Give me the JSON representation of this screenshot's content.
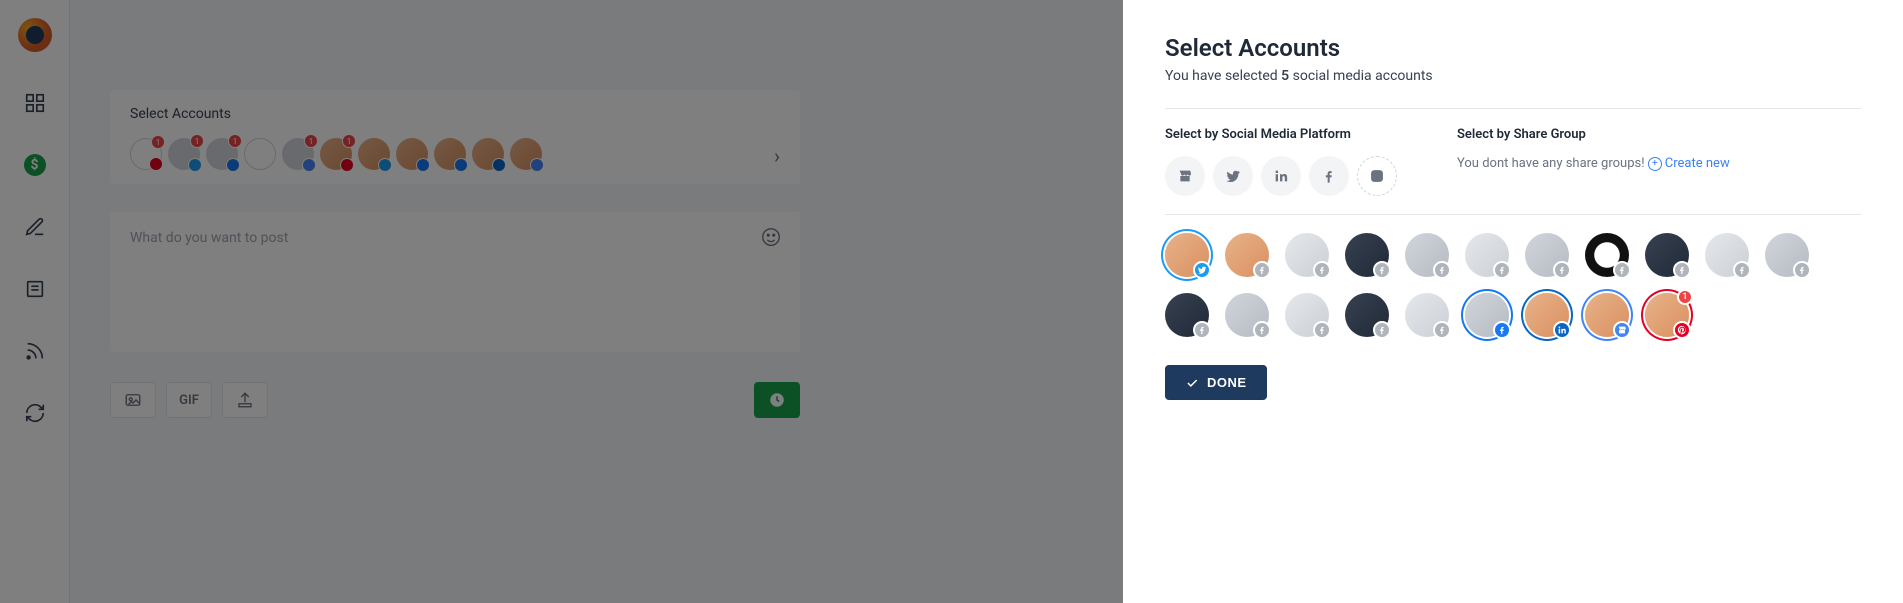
{
  "nav": {
    "items": [
      "dashboard",
      "monetize",
      "compose",
      "content",
      "rss",
      "refresh"
    ]
  },
  "composer": {
    "section_label": "Select Accounts",
    "placeholder": "What do you want to post",
    "gif_label": "GIF",
    "mini_accounts": [
      {
        "net": "pin",
        "hollow": true,
        "count": "1"
      },
      {
        "net": "tw",
        "count": "1"
      },
      {
        "net": "fb",
        "count": "1"
      },
      {
        "net": "none",
        "hollow": true
      },
      {
        "net": "gmb",
        "count": "1"
      },
      {
        "net": "pin",
        "face": true,
        "count": "1"
      },
      {
        "net": "tw",
        "face": true
      },
      {
        "net": "fb",
        "face": true
      },
      {
        "net": "fb",
        "face": true
      },
      {
        "net": "li",
        "face": true
      },
      {
        "net": "gmb",
        "face": true
      }
    ]
  },
  "drawer": {
    "title": "Select Accounts",
    "subtitle_prefix": "You have selected ",
    "selected_count": "5",
    "subtitle_suffix": " social media accounts",
    "platform_label": "Select by Social Media Platform",
    "share_group_label": "Select by Share Group",
    "no_groups_msg": "You dont have any share groups! ",
    "create_new": "Create new",
    "done_label": "DONE",
    "platforms": [
      "gmb",
      "tw",
      "li",
      "fb",
      "ig"
    ],
    "accounts": [
      {
        "net": "tw",
        "selected": true,
        "variant": "tw",
        "cls": "av-face"
      },
      {
        "net": "fbg",
        "cls": "av-face"
      },
      {
        "net": "fbg",
        "cls": "av-gray1"
      },
      {
        "net": "fbg",
        "cls": "av-dark"
      },
      {
        "net": "fbg",
        "cls": "av-gray2"
      },
      {
        "net": "fbg",
        "cls": "av-gray1"
      },
      {
        "net": "fbg",
        "cls": "av-gray2"
      },
      {
        "net": "fbg",
        "cls": "av-bw"
      },
      {
        "net": "fbg",
        "cls": "av-dark"
      },
      {
        "net": "fbg",
        "cls": "av-gray1"
      },
      {
        "net": "fbg",
        "cls": "av-gray2"
      },
      {
        "net": "fbg",
        "cls": "av-dark"
      },
      {
        "net": "fbg",
        "cls": "av-gray2"
      },
      {
        "net": "fbg",
        "cls": "av-gray1"
      },
      {
        "net": "fbg",
        "cls": "av-dark"
      },
      {
        "net": "fbg",
        "cls": "av-gray1"
      },
      {
        "net": "fb",
        "selected": true,
        "variant": "fb",
        "cls": "av-gray2"
      },
      {
        "net": "li",
        "selected": true,
        "variant": "li",
        "cls": "av-face"
      },
      {
        "net": "gmb",
        "selected": true,
        "variant": "gmb",
        "cls": "av-face"
      },
      {
        "net": "pin",
        "selected": true,
        "variant": "pin",
        "cls": "av-face",
        "count": "1"
      }
    ]
  }
}
